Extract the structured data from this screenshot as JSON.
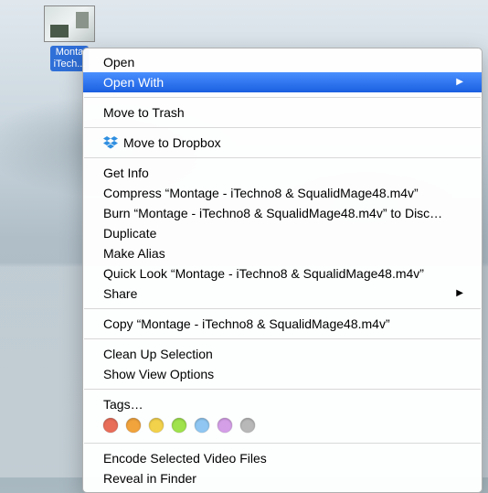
{
  "file": {
    "label_line1": "Monta",
    "label_line2": "iTech..."
  },
  "menu": {
    "open": "Open",
    "open_with": "Open With",
    "move_to_trash": "Move to Trash",
    "move_to_dropbox": "Move to Dropbox",
    "get_info": "Get Info",
    "compress": "Compress “Montage - iTechno8 & SqualidMage48.m4v”",
    "burn": "Burn “Montage - iTechno8 & SqualidMage48.m4v” to Disc…",
    "duplicate": "Duplicate",
    "make_alias": "Make Alias",
    "quick_look": "Quick Look “Montage - iTechno8 & SqualidMage48.m4v”",
    "share": "Share",
    "copy": "Copy “Montage - iTechno8 & SqualidMage48.m4v”",
    "clean_up": "Clean Up Selection",
    "show_view_options": "Show View Options",
    "tags": "Tags…",
    "encode": "Encode Selected Video Files",
    "reveal": "Reveal in Finder"
  },
  "tag_colors": [
    "#e86e5a",
    "#f1a33c",
    "#f3d24b",
    "#9fe24c",
    "#8fc7f2",
    "#d59fe8",
    "#b8b8b8"
  ]
}
